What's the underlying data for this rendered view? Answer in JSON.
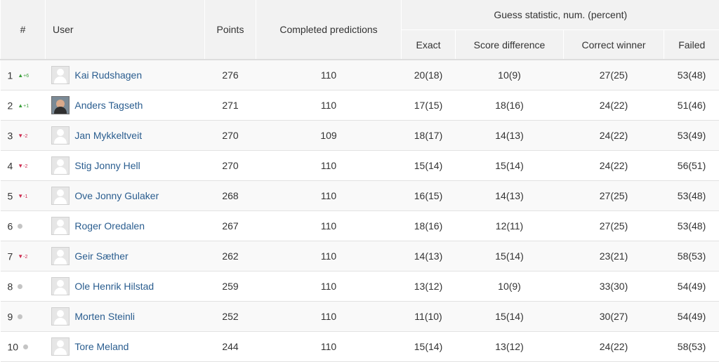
{
  "headers": {
    "rank": "#",
    "user": "User",
    "points": "Points",
    "completed": "Completed predictions",
    "guess_group": "Guess statistic, num. (percent)",
    "exact": "Exact",
    "score_diff": "Score difference",
    "correct_winner": "Correct winner",
    "failed": "Failed"
  },
  "colors": {
    "up": "#3c9f3c",
    "down": "#cc2b4f",
    "same": "#c4c4c4",
    "link": "#2a5d8f"
  },
  "rows": [
    {
      "rank": "1",
      "trend": "up",
      "change": "+6",
      "avatar": "placeholder-avatar",
      "name": "Kai Rudshagen",
      "points": "276",
      "completed": "110",
      "exact": "20(18)",
      "score_diff": "10(9)",
      "correct_winner": "27(25)",
      "failed": "53(48)"
    },
    {
      "rank": "2",
      "trend": "up",
      "change": "+1",
      "avatar": "photo-avatar",
      "name": "Anders Tagseth",
      "points": "271",
      "completed": "110",
      "exact": "17(15)",
      "score_diff": "18(16)",
      "correct_winner": "24(22)",
      "failed": "51(46)"
    },
    {
      "rank": "3",
      "trend": "down",
      "change": "-2",
      "avatar": "placeholder-avatar",
      "name": "Jan Mykkeltveit",
      "points": "270",
      "completed": "109",
      "exact": "18(17)",
      "score_diff": "14(13)",
      "correct_winner": "24(22)",
      "failed": "53(49)"
    },
    {
      "rank": "4",
      "trend": "down",
      "change": "-2",
      "avatar": "placeholder-avatar",
      "name": "Stig Jonny Hell",
      "points": "270",
      "completed": "110",
      "exact": "15(14)",
      "score_diff": "15(14)",
      "correct_winner": "24(22)",
      "failed": "56(51)"
    },
    {
      "rank": "5",
      "trend": "down",
      "change": "-1",
      "avatar": "placeholder-avatar",
      "name": "Ove Jonny Gulaker",
      "points": "268",
      "completed": "110",
      "exact": "16(15)",
      "score_diff": "14(13)",
      "correct_winner": "27(25)",
      "failed": "53(48)"
    },
    {
      "rank": "6",
      "trend": "same",
      "change": "",
      "avatar": "placeholder-avatar",
      "name": "Roger Oredalen",
      "points": "267",
      "completed": "110",
      "exact": "18(16)",
      "score_diff": "12(11)",
      "correct_winner": "27(25)",
      "failed": "53(48)"
    },
    {
      "rank": "7",
      "trend": "down",
      "change": "-2",
      "avatar": "placeholder-avatar",
      "name": "Geir Sæther",
      "points": "262",
      "completed": "110",
      "exact": "14(13)",
      "score_diff": "15(14)",
      "correct_winner": "23(21)",
      "failed": "58(53)"
    },
    {
      "rank": "8",
      "trend": "same",
      "change": "",
      "avatar": "placeholder-avatar",
      "name": "Ole Henrik Hilstad",
      "points": "259",
      "completed": "110",
      "exact": "13(12)",
      "score_diff": "10(9)",
      "correct_winner": "33(30)",
      "failed": "54(49)"
    },
    {
      "rank": "9",
      "trend": "same",
      "change": "",
      "avatar": "placeholder-avatar",
      "name": "Morten Steinli",
      "points": "252",
      "completed": "110",
      "exact": "11(10)",
      "score_diff": "15(14)",
      "correct_winner": "30(27)",
      "failed": "54(49)"
    },
    {
      "rank": "10",
      "trend": "same",
      "change": "",
      "avatar": "placeholder-avatar",
      "name": "Tore Meland",
      "points": "244",
      "completed": "110",
      "exact": "15(14)",
      "score_diff": "13(12)",
      "correct_winner": "24(22)",
      "failed": "58(53)"
    }
  ]
}
